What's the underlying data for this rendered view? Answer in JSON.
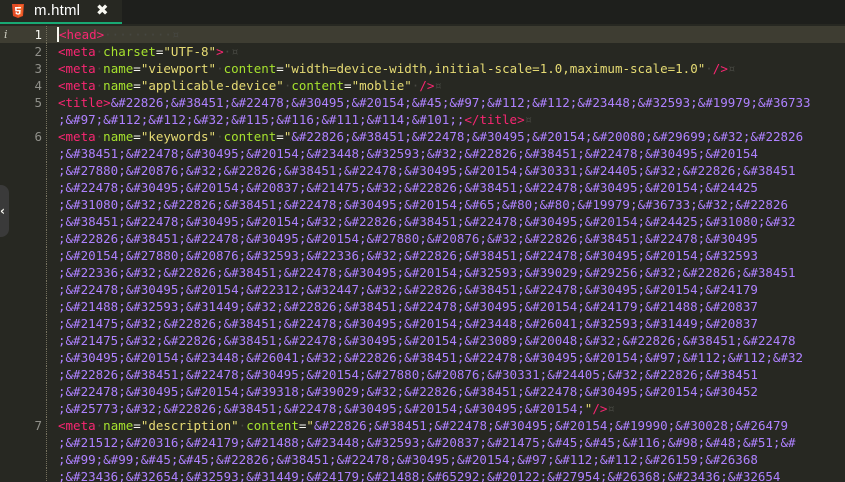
{
  "tab": {
    "filename": "m.html",
    "file_icon": "html5-icon",
    "close_icon": "close-icon",
    "accent_color": "#19a974"
  },
  "editor": {
    "gutter_info_icon": "i",
    "side_handle": "‹",
    "line_numbers": [
      "1",
      "2",
      "3",
      "4",
      "5",
      "6",
      "7"
    ],
    "lines": [
      {
        "n": "1",
        "tokens": [
          [
            "tag",
            "<head>"
          ],
          [
            "ws",
            "·········¤"
          ]
        ]
      },
      {
        "n": "2",
        "tokens": [
          [
            "tag",
            "<meta"
          ],
          [
            "ws",
            "·"
          ],
          [
            "attr",
            "charset"
          ],
          [
            "plain",
            "="
          ],
          [
            "str",
            "\"UTF-8\""
          ],
          [
            "tag",
            ">"
          ],
          [
            "ws",
            "·¤"
          ]
        ]
      },
      {
        "n": "3",
        "tokens": [
          [
            "tag",
            "<meta"
          ],
          [
            "ws",
            "·"
          ],
          [
            "attr",
            "name"
          ],
          [
            "plain",
            "="
          ],
          [
            "str",
            "\"viewport\""
          ],
          [
            "ws",
            "·"
          ],
          [
            "attr",
            "content"
          ],
          [
            "plain",
            "="
          ],
          [
            "str",
            "\"width=device-width,initial-scale=1.0,maximum-scale=1.0\""
          ],
          [
            "ws",
            "·"
          ],
          [
            "tag",
            "/>"
          ],
          [
            "ws",
            "¤"
          ]
        ]
      },
      {
        "n": "4",
        "tokens": [
          [
            "tag",
            "<meta"
          ],
          [
            "ws",
            "·"
          ],
          [
            "attr",
            "name"
          ],
          [
            "plain",
            "="
          ],
          [
            "str",
            "\"applicable-device\""
          ],
          [
            "ws",
            "·"
          ],
          [
            "attr",
            "content"
          ],
          [
            "plain",
            "="
          ],
          [
            "str",
            "\"moblie\""
          ],
          [
            "ws",
            "·"
          ],
          [
            "tag",
            "/>"
          ],
          [
            "ws",
            "¤"
          ]
        ]
      },
      {
        "n": "5",
        "tokens": [
          [
            "tag",
            "<title>"
          ],
          [
            "ent",
            "&#22826;&#38451;&#22478;&#30495;&#20154;&#45;&#97;&#112;&#112;&#23448;&#32593;&#19979;&#36733"
          ]
        ]
      },
      {
        "n": "",
        "tokens": [
          [
            "ent",
            ";&#97;&#112;&#112;&#32;&#115;&#116;&#111;&#114;&#101;;"
          ],
          [
            "tag",
            "</title>"
          ],
          [
            "ws",
            "¤"
          ]
        ]
      },
      {
        "n": "6",
        "tokens": [
          [
            "tag",
            "<meta"
          ],
          [
            "ws",
            "·"
          ],
          [
            "attr",
            "name"
          ],
          [
            "plain",
            "="
          ],
          [
            "str",
            "\"keywords\""
          ],
          [
            "ws",
            "·"
          ],
          [
            "attr",
            "content"
          ],
          [
            "plain",
            "="
          ],
          [
            "str",
            "\""
          ],
          [
            "ent",
            "&#22826;&#38451;&#22478;&#30495;&#20154;&#20080;&#29699;&#32;&#22826"
          ]
        ]
      },
      {
        "n": "",
        "tokens": [
          [
            "ent",
            ";&#38451;&#22478;&#30495;&#20154;&#23448;&#32593;&#32;&#22826;&#38451;&#22478;&#30495;&#20154"
          ]
        ]
      },
      {
        "n": "",
        "tokens": [
          [
            "ent",
            ";&#27880;&#20876;&#32;&#22826;&#38451;&#22478;&#30495;&#20154;&#30331;&#24405;&#32;&#22826;&#38451"
          ]
        ]
      },
      {
        "n": "",
        "tokens": [
          [
            "ent",
            ";&#22478;&#30495;&#20154;&#20837;&#21475;&#32;&#22826;&#38451;&#22478;&#30495;&#20154;&#24425"
          ]
        ]
      },
      {
        "n": "",
        "tokens": [
          [
            "ent",
            ";&#31080;&#32;&#22826;&#38451;&#22478;&#30495;&#20154;&#65;&#80;&#80;&#19979;&#36733;&#32;&#22826"
          ]
        ]
      },
      {
        "n": "",
        "tokens": [
          [
            "ent",
            ";&#38451;&#22478;&#30495;&#20154;&#32;&#22826;&#38451;&#22478;&#30495;&#20154;&#24425;&#31080;&#32"
          ]
        ]
      },
      {
        "n": "",
        "tokens": [
          [
            "ent",
            ";&#22826;&#38451;&#22478;&#30495;&#20154;&#27880;&#20876;&#32;&#22826;&#38451;&#22478;&#30495"
          ]
        ]
      },
      {
        "n": "",
        "tokens": [
          [
            "ent",
            ";&#20154;&#27880;&#20876;&#32593;&#22336;&#32;&#22826;&#38451;&#22478;&#30495;&#20154;&#32593"
          ]
        ]
      },
      {
        "n": "",
        "tokens": [
          [
            "ent",
            ";&#22336;&#32;&#22826;&#38451;&#22478;&#30495;&#20154;&#32593;&#39029;&#29256;&#32;&#22826;&#38451"
          ]
        ]
      },
      {
        "n": "",
        "tokens": [
          [
            "ent",
            ";&#22478;&#30495;&#20154;&#22312;&#32447;&#32;&#22826;&#38451;&#22478;&#30495;&#20154;&#24179"
          ]
        ]
      },
      {
        "n": "",
        "tokens": [
          [
            "ent",
            ";&#21488;&#32593;&#31449;&#32;&#22826;&#38451;&#22478;&#30495;&#20154;&#24179;&#21488;&#20837"
          ]
        ]
      },
      {
        "n": "",
        "tokens": [
          [
            "ent",
            ";&#21475;&#32;&#22826;&#38451;&#22478;&#30495;&#20154;&#23448;&#26041;&#32593;&#31449;&#20837"
          ]
        ]
      },
      {
        "n": "",
        "tokens": [
          [
            "ent",
            ";&#21475;&#32;&#22826;&#38451;&#22478;&#30495;&#20154;&#23089;&#20048;&#32;&#22826;&#38451;&#22478"
          ]
        ]
      },
      {
        "n": "",
        "tokens": [
          [
            "ent",
            ";&#30495;&#20154;&#23448;&#26041;&#32;&#22826;&#38451;&#22478;&#30495;&#20154;&#97;&#112;&#112;&#32"
          ]
        ]
      },
      {
        "n": "",
        "tokens": [
          [
            "ent",
            ";&#22826;&#38451;&#22478;&#30495;&#20154;&#27880;&#20876;&#30331;&#24405;&#32;&#22826;&#38451"
          ]
        ]
      },
      {
        "n": "",
        "tokens": [
          [
            "ent",
            ";&#22478;&#30495;&#20154;&#39318;&#39029;&#32;&#22826;&#38451;&#22478;&#30495;&#20154;&#30452"
          ]
        ]
      },
      {
        "n": "",
        "tokens": [
          [
            "ent",
            ";&#25773;&#32;&#22826;&#38451;&#22478;&#30495;&#20154;&#30495;&#20154;"
          ],
          [
            "str",
            "\""
          ],
          [
            "tag",
            "/>"
          ],
          [
            "ws",
            "¤"
          ]
        ]
      },
      {
        "n": "7",
        "tokens": [
          [
            "tag",
            "<meta"
          ],
          [
            "ws",
            "·"
          ],
          [
            "attr",
            "name"
          ],
          [
            "plain",
            "="
          ],
          [
            "str",
            "\"description\""
          ],
          [
            "ws",
            "·"
          ],
          [
            "attr",
            "content"
          ],
          [
            "plain",
            "="
          ],
          [
            "str",
            "\""
          ],
          [
            "ent",
            "&#22826;&#38451;&#22478;&#30495;&#20154;&#19990;&#30028;&#26479"
          ]
        ]
      },
      {
        "n": "",
        "tokens": [
          [
            "ent",
            ";&#21512;&#20316;&#24179;&#21488;&#23448;&#32593;&#20837;&#21475;&#45;&#45;&#116;&#98;&#48;&#51;&#"
          ]
        ]
      },
      {
        "n": "",
        "tokens": [
          [
            "ent",
            ";&#99;&#99;&#45;&#45;&#22826;&#38451;&#22478;&#30495;&#20154;&#97;&#112;&#112;&#26159;&#26368"
          ]
        ]
      },
      {
        "n": "",
        "tokens": [
          [
            "ent",
            ";&#23436;&#32654;&#32593;&#31449;&#24179;&#21488;&#65292;&#20122;&#27954;&#26368;&#23436;&#32654"
          ]
        ]
      }
    ]
  }
}
